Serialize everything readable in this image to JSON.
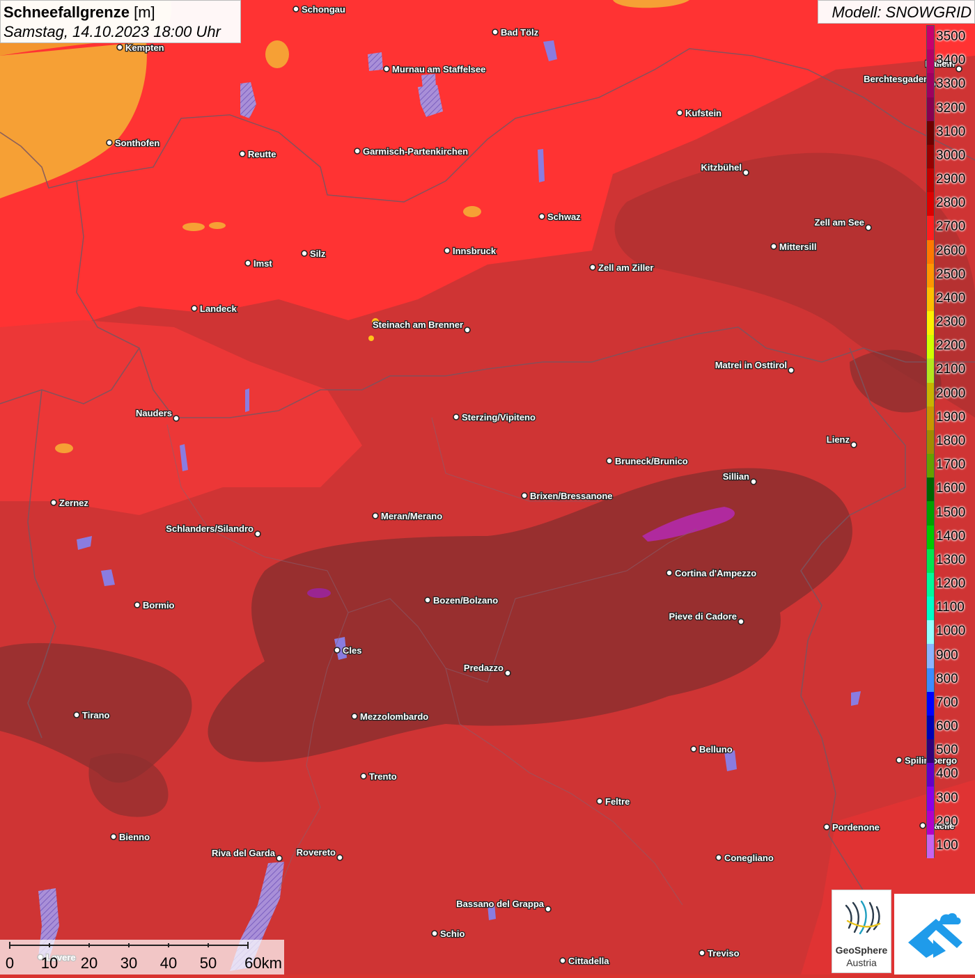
{
  "title": {
    "main": "Schneefallgrenze",
    "unit": "[m]",
    "datetime": "Samstag, 14.10.2023 18:00 Uhr"
  },
  "model": "Modell: SNOWGRID",
  "legend": [
    {
      "label": "3500",
      "color": "#c8006e"
    },
    {
      "label": "3400",
      "color": "#b40066"
    },
    {
      "label": "3300",
      "color": "#9e0060"
    },
    {
      "label": "3200",
      "color": "#880050"
    },
    {
      "label": "3100",
      "color": "#6e0000"
    },
    {
      "label": "3000",
      "color": "#960000"
    },
    {
      "label": "2900",
      "color": "#be0000"
    },
    {
      "label": "2800",
      "color": "#dc0000"
    },
    {
      "label": "2700",
      "color": "#ff1e1e"
    },
    {
      "label": "2600",
      "color": "#ff7800"
    },
    {
      "label": "2500",
      "color": "#ff9600"
    },
    {
      "label": "2400",
      "color": "#ffbe00"
    },
    {
      "label": "2300",
      "color": "#fff000"
    },
    {
      "label": "2200",
      "color": "#d2ff00"
    },
    {
      "label": "2100",
      "color": "#b4e61e"
    },
    {
      "label": "2000",
      "color": "#c8b400"
    },
    {
      "label": "1900",
      "color": "#c89600"
    },
    {
      "label": "1800",
      "color": "#a08c00"
    },
    {
      "label": "1700",
      "color": "#64a000"
    },
    {
      "label": "1600",
      "color": "#006400"
    },
    {
      "label": "1500",
      "color": "#00a000"
    },
    {
      "label": "1400",
      "color": "#00c800"
    },
    {
      "label": "1300",
      "color": "#00e650"
    },
    {
      "label": "1200",
      "color": "#00fa9a"
    },
    {
      "label": "1100",
      "color": "#00ffc8"
    },
    {
      "label": "1000",
      "color": "#96ffff"
    },
    {
      "label": "900",
      "color": "#8cb4ff"
    },
    {
      "label": "800",
      "color": "#3c8cff"
    },
    {
      "label": "700",
      "color": "#0000ff"
    },
    {
      "label": "600",
      "color": "#0000b4"
    },
    {
      "label": "500",
      "color": "#320078"
    },
    {
      "label": "400",
      "color": "#6400c8"
    },
    {
      "label": "300",
      "color": "#8c00e6"
    },
    {
      "label": "200",
      "color": "#b400c8"
    },
    {
      "label": "100",
      "color": "#c864f0"
    }
  ],
  "cities": [
    {
      "name": "Schongau"
    },
    {
      "name": "Bad Tölz"
    },
    {
      "name": "Kempten"
    },
    {
      "name": "Murnau am Staffelsee"
    },
    {
      "name": "Hallein"
    },
    {
      "name": "Berchtesgaden"
    },
    {
      "name": "Kufstein"
    },
    {
      "name": "Sonthofen"
    },
    {
      "name": "Reutte"
    },
    {
      "name": "Garmisch-Partenkirchen"
    },
    {
      "name": "Kitzbühel"
    },
    {
      "name": "Schwaz"
    },
    {
      "name": "Zell am See"
    },
    {
      "name": "Mittersill"
    },
    {
      "name": "Innsbruck"
    },
    {
      "name": "Silz"
    },
    {
      "name": "Imst"
    },
    {
      "name": "Zell am Ziller"
    },
    {
      "name": "Landeck"
    },
    {
      "name": "Steinach am Brenner"
    },
    {
      "name": "Matrei in Osttirol"
    },
    {
      "name": "Nauders"
    },
    {
      "name": "Sterzing/Vipiteno"
    },
    {
      "name": "Lienz"
    },
    {
      "name": "Bruneck/Brunico"
    },
    {
      "name": "Sillian"
    },
    {
      "name": "Zernez"
    },
    {
      "name": "Brixen/Bressanone"
    },
    {
      "name": "Meran/Merano"
    },
    {
      "name": "Schlanders/Silandro"
    },
    {
      "name": "Cortina d'Ampezzo"
    },
    {
      "name": "Bozen/Bolzano"
    },
    {
      "name": "Bormio"
    },
    {
      "name": "Pieve di Cadore"
    },
    {
      "name": "Cles"
    },
    {
      "name": "Predazzo"
    },
    {
      "name": "Tirano"
    },
    {
      "name": "Mezzolombardo"
    },
    {
      "name": "Belluno"
    },
    {
      "name": "Spilimbergo"
    },
    {
      "name": "Trento"
    },
    {
      "name": "Feltre"
    },
    {
      "name": "Pordenone"
    },
    {
      "name": "Sacile"
    },
    {
      "name": "Bienno"
    },
    {
      "name": "Riva del Garda"
    },
    {
      "name": "Rovereto"
    },
    {
      "name": "Conegliano"
    },
    {
      "name": "Bassano del Grappa"
    },
    {
      "name": "Schio"
    },
    {
      "name": "Treviso"
    },
    {
      "name": "Lovere"
    },
    {
      "name": "Cittadella"
    }
  ],
  "scalebar": [
    "0",
    "10",
    "20",
    "30",
    "40",
    "50",
    "60km"
  ],
  "logos": {
    "geosphere_line1": "GeoSphere",
    "geosphere_line2": "Austria"
  }
}
